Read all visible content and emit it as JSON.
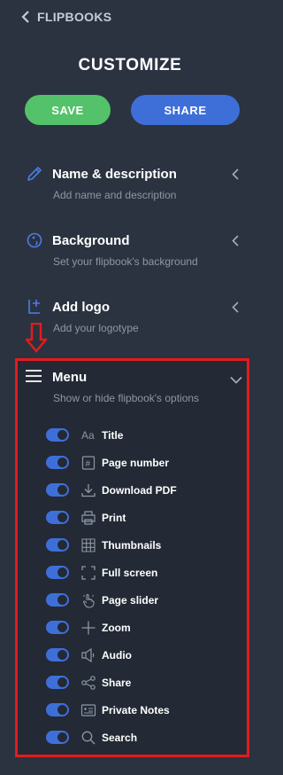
{
  "nav": {
    "back_label": "FLIPBOOKS"
  },
  "page": {
    "title": "CUSTOMIZE"
  },
  "actions": {
    "save_label": "SAVE",
    "share_label": "SHARE"
  },
  "sections": [
    {
      "title": "Name & description",
      "subtitle": "Add name and description",
      "icon": "pencil-icon"
    },
    {
      "title": "Background",
      "subtitle": "Set your flipbook's background",
      "icon": "palette-icon"
    },
    {
      "title": "Add logo",
      "subtitle": "Add your logotype",
      "icon": "add-logo-icon"
    }
  ],
  "menu": {
    "title": "Menu",
    "subtitle": "Show or hide flipbook's options",
    "options": [
      {
        "label": "Title",
        "icon": "text-icon",
        "enabled": true
      },
      {
        "label": "Page number",
        "icon": "hash-icon",
        "enabled": true
      },
      {
        "label": "Download PDF",
        "icon": "download-icon",
        "enabled": true
      },
      {
        "label": "Print",
        "icon": "printer-icon",
        "enabled": true
      },
      {
        "label": "Thumbnails",
        "icon": "grid-icon",
        "enabled": true
      },
      {
        "label": "Full screen",
        "icon": "fullscreen-icon",
        "enabled": true
      },
      {
        "label": "Page slider",
        "icon": "hand-pointer-icon",
        "enabled": true
      },
      {
        "label": "Zoom",
        "icon": "plus-icon",
        "enabled": true
      },
      {
        "label": "Audio",
        "icon": "speaker-icon",
        "enabled": true
      },
      {
        "label": "Share",
        "icon": "share-icon",
        "enabled": true
      },
      {
        "label": "Private Notes",
        "icon": "notes-icon",
        "enabled": true
      },
      {
        "label": "Search",
        "icon": "search-icon",
        "enabled": true
      }
    ]
  },
  "colors": {
    "background": "#2b3340",
    "save": "#54c26a",
    "share": "#3e6fd9",
    "toggle_on": "#3e6fd9",
    "highlight": "#e41b1b",
    "section_icon": "#4a7de8"
  }
}
